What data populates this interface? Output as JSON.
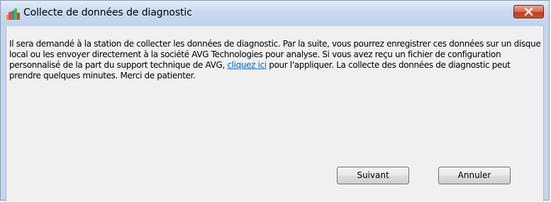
{
  "window": {
    "title": "Collecte de données de diagnostic",
    "icon": "avg-logo-icon",
    "close_icon": "close-icon"
  },
  "message": {
    "text_before_link": "Il sera demandé à la station de collecter les données de diagnostic. Par la suite, vous pourrez enregistrer ces données sur un disque local ou les envoyer directement à la société AVG Technologies pour analyse. Si vous avez reçu un fichier de configuration personnalisé de la part du support technique de AVG, ",
    "link_text": "cliquez ici",
    "text_after_link": " pour l'appliquer. La collecte des données de diagnostic peut prendre quelques minutes. Merci de patienter."
  },
  "buttons": {
    "next_label": "Suivant",
    "cancel_label": "Annuler"
  },
  "colors": {
    "link": "#0066cc",
    "close_button": "#c23a1f",
    "dialog_background": "#f0f0f0"
  }
}
